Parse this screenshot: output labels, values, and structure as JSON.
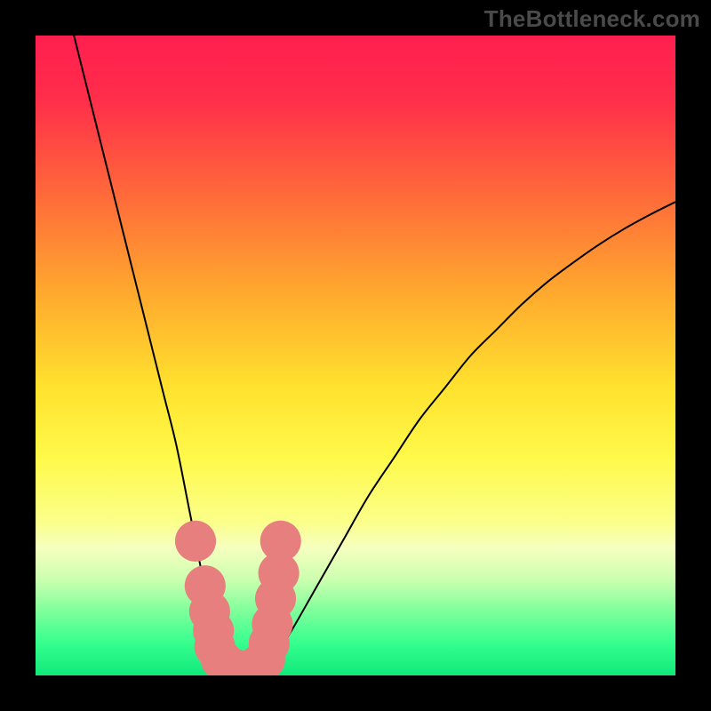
{
  "watermark": "TheBottleneck.com",
  "chart_data": {
    "type": "line",
    "title": "",
    "xlabel": "",
    "ylabel": "",
    "xlim": [
      0,
      100
    ],
    "ylim": [
      0,
      100
    ],
    "grid": false,
    "background": {
      "type": "vertical_gradient",
      "stops": [
        {
          "y": 0,
          "color": "#ff1f4f"
        },
        {
          "y": 10,
          "color": "#ff2e4a"
        },
        {
          "y": 25,
          "color": "#ff6a3a"
        },
        {
          "y": 40,
          "color": "#ffa82e"
        },
        {
          "y": 55,
          "color": "#ffe22e"
        },
        {
          "y": 66,
          "color": "#fff94a"
        },
        {
          "y": 76,
          "color": "#fbff8a"
        },
        {
          "y": 80,
          "color": "#f6ffbf"
        },
        {
          "y": 85,
          "color": "#ccffb0"
        },
        {
          "y": 90,
          "color": "#7dff9a"
        },
        {
          "y": 95,
          "color": "#35ff8e"
        },
        {
          "y": 100,
          "color": "#11e87a"
        }
      ]
    },
    "series": [
      {
        "name": "bottleneck_curve",
        "stroke": "#000000",
        "stroke_width": 2,
        "x": [
          6,
          8,
          10,
          12,
          14,
          16,
          18,
          20,
          22,
          24,
          25,
          26,
          27,
          28,
          29,
          30,
          31,
          32,
          33,
          34,
          35,
          36,
          38,
          40,
          44,
          48,
          52,
          56,
          60,
          64,
          68,
          72,
          76,
          80,
          84,
          88,
          92,
          96,
          100
        ],
        "y": [
          100,
          92,
          84,
          76,
          68,
          60,
          52,
          44,
          36,
          26,
          21,
          16,
          12,
          8,
          5,
          3,
          2,
          1,
          0.5,
          0.5,
          1,
          2,
          4,
          7,
          14,
          21,
          28,
          34,
          40,
          45,
          50,
          54,
          58,
          61.5,
          64.5,
          67.3,
          69.8,
          72,
          74
        ]
      }
    ],
    "markers": [
      {
        "name": "highlight_near_minimum",
        "shape": "circle",
        "color": "#e77f7f",
        "radius": 3.2,
        "points": [
          {
            "x": 25.0,
            "y": 21
          },
          {
            "x": 26.5,
            "y": 14
          },
          {
            "x": 27.2,
            "y": 10
          },
          {
            "x": 27.8,
            "y": 7
          },
          {
            "x": 28.0,
            "y": 4.5
          },
          {
            "x": 29.0,
            "y": 2.5
          },
          {
            "x": 30.0,
            "y": 1.5
          },
          {
            "x": 31.0,
            "y": 1.0
          },
          {
            "x": 32.0,
            "y": 0.7
          },
          {
            "x": 33.0,
            "y": 0.7
          },
          {
            "x": 34.0,
            "y": 1.0
          },
          {
            "x": 35.0,
            "y": 1.7
          },
          {
            "x": 35.8,
            "y": 2.5
          },
          {
            "x": 36.5,
            "y": 5.0
          },
          {
            "x": 37.0,
            "y": 8.0
          },
          {
            "x": 37.5,
            "y": 12.0
          },
          {
            "x": 38.0,
            "y": 16.0
          },
          {
            "x": 38.3,
            "y": 21.0
          }
        ]
      }
    ]
  }
}
